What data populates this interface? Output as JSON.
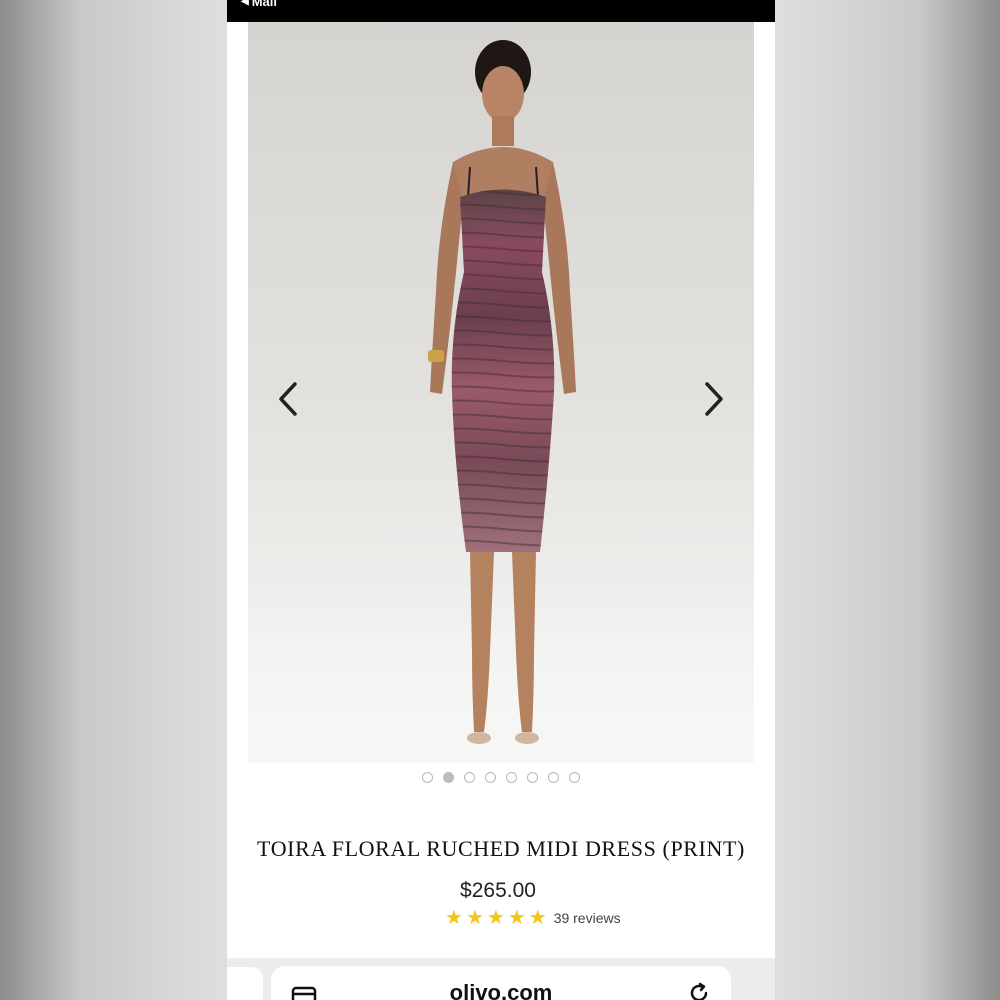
{
  "status_bar": {
    "back_label": "Mail",
    "back_icon": "back-triangle-icon"
  },
  "gallery": {
    "prev_icon": "chevron-left-icon",
    "next_icon": "chevron-right-icon",
    "image_count": 8,
    "active_index": 1
  },
  "product": {
    "title": "TOIRA FLORAL RUCHED MIDI DRESS (PRINT)",
    "price": "$265.00",
    "rating_stars": 5,
    "reviews": "39 reviews",
    "star_color": "#f5c518"
  },
  "browser": {
    "url": "olivo.com",
    "tabs_icon": "tabs-icon",
    "reload_icon": "reload-icon"
  }
}
